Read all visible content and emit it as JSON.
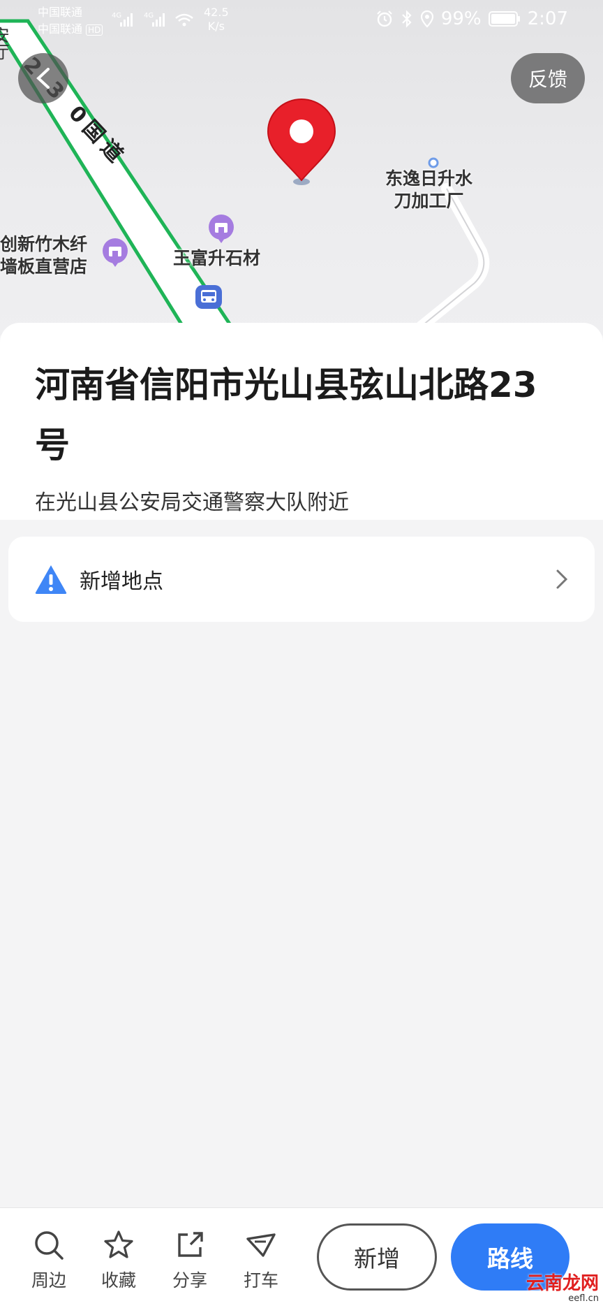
{
  "status_bar": {
    "carrier1": "中国联通",
    "carrier2": "中国联通",
    "hd": "HD",
    "net1": "4G",
    "net2": "4G",
    "speed_value": "42.5",
    "speed_unit": "K/s",
    "battery": "99%",
    "time": "2:07"
  },
  "map": {
    "road_label": "2 3 0国道",
    "left_edge_label": "安厅",
    "poi_factory": "东逸日升水\n刀加工厂",
    "poi_shop_left": "创新竹木纤\n墙板直营店",
    "poi_stone": "王富升石材",
    "feedback_label": "反馈"
  },
  "info": {
    "title": "河南省信阳市光山县弦山北路23号",
    "subtitle": "在光山县公安局交通警察大队附近"
  },
  "add_location": {
    "label": "新增地点"
  },
  "bottom_bar": {
    "nearby": "周边",
    "favorite": "收藏",
    "share": "分享",
    "taxi": "打车",
    "add": "新增",
    "route": "路线"
  },
  "watermark": {
    "text": "云南龙网",
    "site": "eefl.cn"
  },
  "colors": {
    "accent": "#2f7cf6",
    "pin": "#e8202a",
    "road_green": "#1fb457",
    "poi_purple": "#a57ce0",
    "warning_blue": "#3f86f6"
  }
}
